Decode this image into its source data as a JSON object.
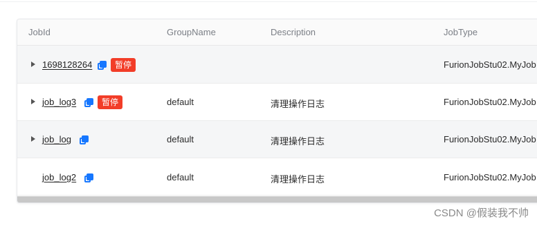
{
  "table": {
    "columns": [
      "JobId",
      "GroupName",
      "Description",
      "JobType"
    ],
    "rows": [
      {
        "job_id": "1698128264",
        "group": "",
        "description": "",
        "job_type": "FurionJobStu02.MyJob",
        "badge": "暂停",
        "expandable": true
      },
      {
        "job_id": "job_log3",
        "group": "default",
        "description": "清理操作日志",
        "job_type": "FurionJobStu02.MyJob",
        "badge": "暂停",
        "expandable": true
      },
      {
        "job_id": "job_log",
        "group": "default",
        "description": "清理操作日志",
        "job_type": "FurionJobStu02.MyJob",
        "badge": "",
        "expandable": true
      },
      {
        "job_id": "job_log2",
        "group": "default",
        "description": "清理操作日志",
        "job_type": "FurionJobStu02.MyJob",
        "badge": "",
        "expandable": false
      }
    ]
  },
  "watermark": "CSDN @假装我不帅",
  "colors": {
    "badge": "#f23d28",
    "copy_icon": "#1677ff",
    "alt_row": "#f5f6f7"
  },
  "icons": [
    "caret-right-icon",
    "copy-icon"
  ]
}
